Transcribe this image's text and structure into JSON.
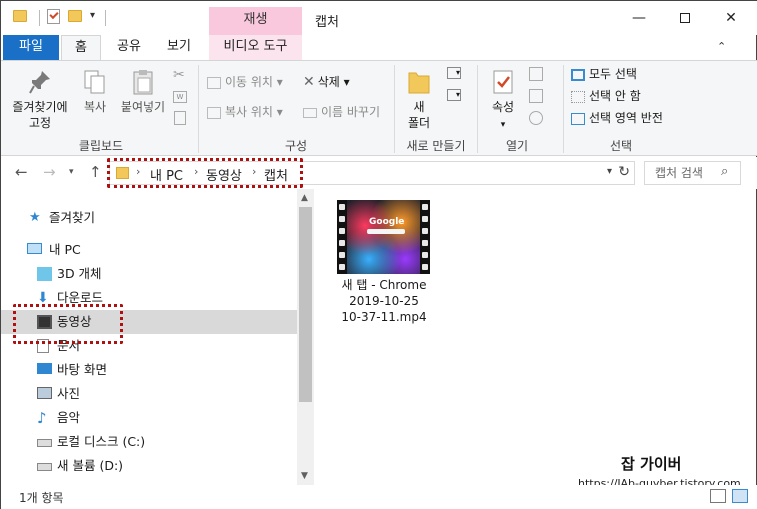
{
  "window": {
    "title": "캡처",
    "context_tab_header": "재생",
    "minimize": "—",
    "close": "✕"
  },
  "tabs": {
    "file": "파일",
    "home": "홈",
    "share": "공유",
    "view": "보기",
    "video_tools": "비디오 도구"
  },
  "ribbon": {
    "clipboard": {
      "label": "클립보드",
      "pin_line1": "즐겨찾기에",
      "pin_line2": "고정",
      "copy": "복사",
      "paste": "붙여넣기"
    },
    "organize": {
      "label": "구성",
      "move_to": "이동 위치",
      "copy_to": "복사 위치",
      "delete": "삭제",
      "rename": "이름 바꾸기"
    },
    "new": {
      "label": "새로 만들기",
      "new_folder_line1": "새",
      "new_folder_line2": "폴더"
    },
    "open": {
      "label": "열기",
      "properties": "속성"
    },
    "select": {
      "label": "선택",
      "select_all": "모두 선택",
      "select_none": "선택 안 함",
      "invert": "선택 영역 반전"
    }
  },
  "address": {
    "segments": [
      "내 PC",
      "동영상",
      "캡처"
    ],
    "search_placeholder": "캡처 검색"
  },
  "nav": {
    "items": [
      {
        "label": "즐겨찾기",
        "icon": "star-icon"
      },
      {
        "label": "내 PC",
        "icon": "computer-icon"
      },
      {
        "label": "3D 개체",
        "icon": "cube-icon"
      },
      {
        "label": "다운로드",
        "icon": "download-icon"
      },
      {
        "label": "동영상",
        "icon": "video-icon"
      },
      {
        "label": "문서",
        "icon": "document-icon"
      },
      {
        "label": "바탕 화면",
        "icon": "desktop-icon"
      },
      {
        "label": "사진",
        "icon": "picture-icon"
      },
      {
        "label": "음악",
        "icon": "music-icon"
      },
      {
        "label": "로컬 디스크 (C:)",
        "icon": "drive-c-icon"
      },
      {
        "label": "새 볼륨 (D:)",
        "icon": "drive-d-icon"
      }
    ]
  },
  "files": [
    {
      "name_line1": "새 탭 - Chrome",
      "name_line2": "2019-10-25",
      "name_line3": "10-37-11.mp4",
      "thumb_text": "Google"
    }
  ],
  "status": {
    "item_count": "1개 항목"
  },
  "watermark": {
    "title": "잡 가이버",
    "url": "https://JAb-guyber.tistory.com"
  },
  "colors": {
    "file_tab": "#1a6fc6",
    "context_tab": "#f9c8dc",
    "highlight": "#b01010",
    "selected_nav": "#d9d9d9"
  }
}
